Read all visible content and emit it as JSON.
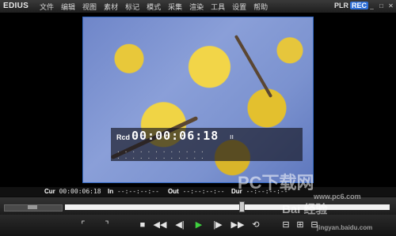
{
  "app": {
    "logo": "EDIUS",
    "plr": "PLR",
    "rec": "REC"
  },
  "menu": [
    "文件",
    "编辑",
    "视图",
    "素材",
    "标记",
    "模式",
    "采集",
    "渲染",
    "工具",
    "设置",
    "帮助"
  ],
  "window_buttons": [
    "_",
    "□",
    "✕"
  ],
  "overlay": {
    "label": "Rcd",
    "timecode": "00:00:06:18",
    "pause_icon": "ıı",
    "dots_line1": "· · · ·   · · · ·   · · · ·",
    "dots_line2": "· · · ·   · · · ·   · · · ·"
  },
  "timecodes": {
    "cur_label": "Cur",
    "cur_value": "00:00:06:18",
    "in_label": "In",
    "in_value": "--:--:--:--",
    "out_label": "Out",
    "out_value": "--:--:--:--",
    "dur_label": "Dur",
    "dur_value": "--:--:--:--"
  },
  "transport": {
    "mark_in": "⌜",
    "mark_out": "⌝",
    "stop": "■",
    "rewind": "◀◀",
    "step_back": "◀|",
    "play": "▶",
    "step_fwd": "|▶",
    "fast_fwd": "▶▶",
    "loop": "⟲",
    "extra": [
      "⊟",
      "⊞",
      "⊟"
    ]
  },
  "watermark": {
    "site1": "PC下载网",
    "site2": "www.pc6.com",
    "site3": "Bai 经验",
    "site4": "jingyan.baidu.com"
  },
  "colors": {
    "accent": "#2f6fd6",
    "frame_border": "#2f65c0",
    "play": "#3fd13f"
  }
}
